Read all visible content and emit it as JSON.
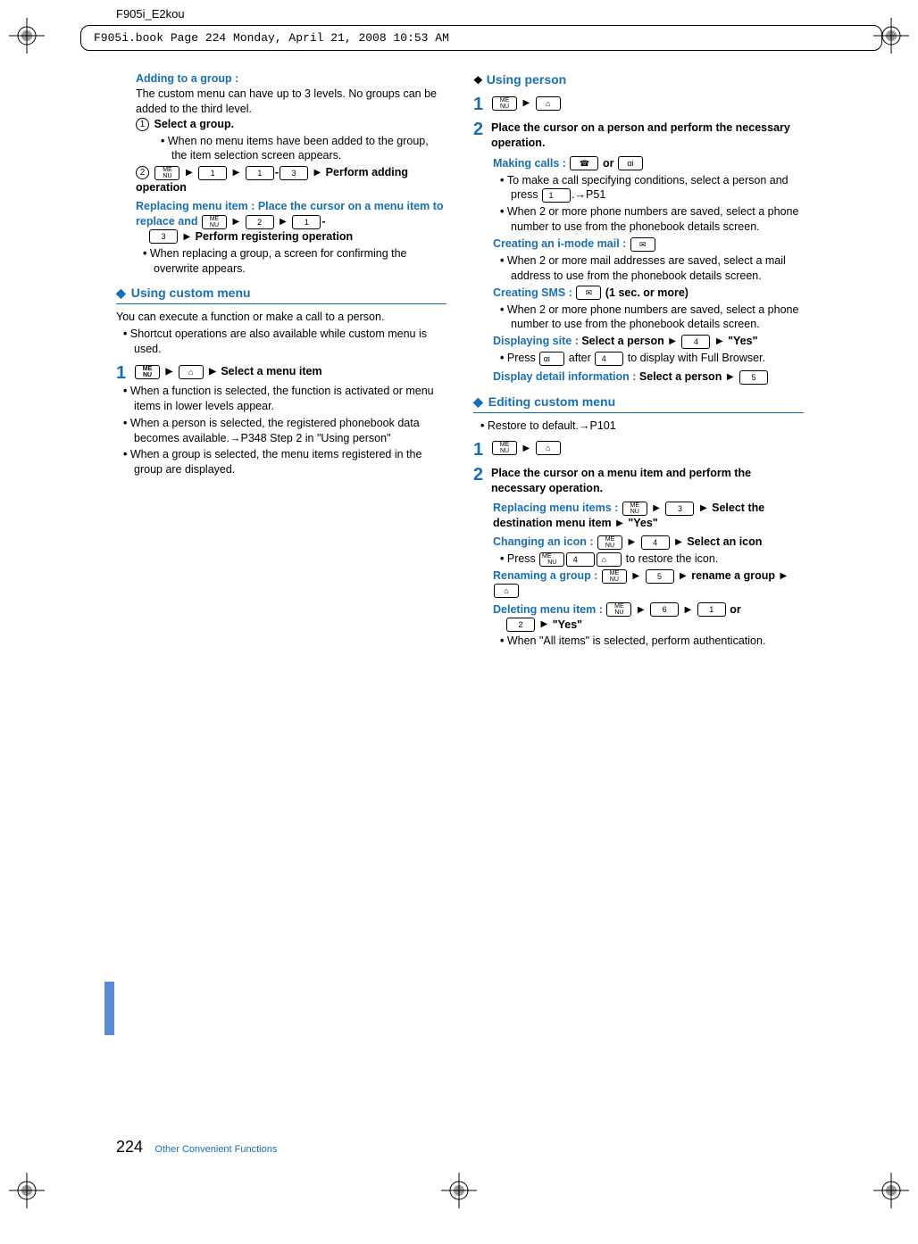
{
  "header": {
    "filelabel": "F905i_E2kou",
    "crop_info": "F905i.book  Page 224  Monday, April 21, 2008  10:53 AM"
  },
  "left": {
    "adding_title": "Adding to a group :",
    "adding_body": "The custom menu can have up to 3 levels. No groups can be added to the third level.",
    "c1_label": "Select a group.",
    "c1_bullet": "When no menu items have been added to the group, the item selection screen appears.",
    "c2_tail": "Perform adding operation",
    "replacing_title": "Replacing menu item : Place the cursor on a menu item to replace and",
    "replacing_tail": "Perform registering operation",
    "replacing_bullet": "When replacing a group, a screen for confirming the overwrite appears.",
    "custom_head": "Using custom menu",
    "custom_body": "You can execute a function or make a call to a person.",
    "custom_bullet": "Shortcut operations are also available while custom menu is used.",
    "step1_tail": "Select a menu item",
    "s1b1": "When a function is selected, the function is activated or menu items in lower levels appear.",
    "s1b2": "When a person is selected, the registered phonebook data becomes available.→P348 Step 2 in \"Using person\"",
    "s1b3": "When a group is selected, the menu items registered in the group are displayed."
  },
  "right": {
    "using_person": "Using person",
    "step2_head": "Place the cursor on a person and perform the necessary operation.",
    "making_calls": "Making calls :",
    "or": "or",
    "mc_b1a": "To make a call specifying conditions, select a person and press",
    "mc_b1b": ".→P51",
    "mc_b2": "When 2 or more phone numbers are saved, select a phone number to use from the phonebook details screen.",
    "imode": "Creating an i-mode mail :",
    "imode_b1": "When 2 or more mail addresses are saved, select a mail address to use from the phonebook details screen.",
    "sms": "Creating SMS :",
    "sms_suffix": "(1 sec. or more)",
    "sms_b1": "When 2 or more phone numbers are saved, select a phone number to use from the phonebook details screen.",
    "dispsite": "Displaying site :",
    "dispsite_b": "Select a person",
    "yes": "\"Yes\"",
    "dispsite_bullet_a": "Press",
    "dispsite_bullet_b": "after",
    "dispsite_bullet_c": "to display with Full Browser.",
    "dispdetail": "Display detail information :",
    "dispdetail_b": "Select a person",
    "editing_head": "Editing custom menu",
    "restore": "Restore to default.→P101",
    "step2e_head": "Place the cursor on a menu item and perform the necessary operation.",
    "repl_items": "Replacing menu items :",
    "repl_items_b": "Select the destination menu item",
    "chicon": "Changing an icon :",
    "chicon_b": "Select an icon",
    "chicon_bullet_a": "Press",
    "chicon_bullet_b": "to restore the icon.",
    "rename": "Renaming a group :",
    "rename_b": "rename a group",
    "delitem": "Deleting menu item :",
    "delitem_bullet": "When \"All items\" is selected, perform authentication."
  },
  "footer": {
    "page": "224",
    "section": "Other Convenient Functions"
  },
  "icons": {
    "me": "ME",
    "book": "📖",
    "one": "1",
    "two": "2",
    "three": "3",
    "four": "4",
    "five": "5",
    "six": "6",
    "phone": "☎",
    "imode": "αi",
    "mail": "✉"
  }
}
